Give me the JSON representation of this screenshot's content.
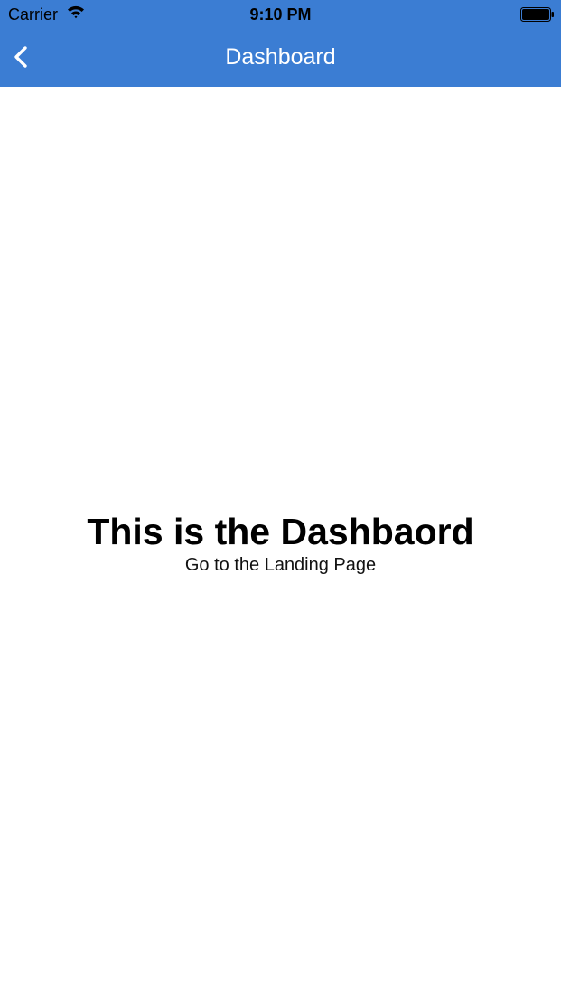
{
  "status_bar": {
    "carrier": "Carrier",
    "time": "9:10 PM",
    "wifi_icon": "wifi-icon",
    "battery_icon": "battery-icon"
  },
  "nav_bar": {
    "title": "Dashboard",
    "back_icon": "chevron-left-icon",
    "background_color": "#3b7dd3"
  },
  "content": {
    "heading": "This is the Dashbaord",
    "link_text": "Go to the Landing Page"
  }
}
